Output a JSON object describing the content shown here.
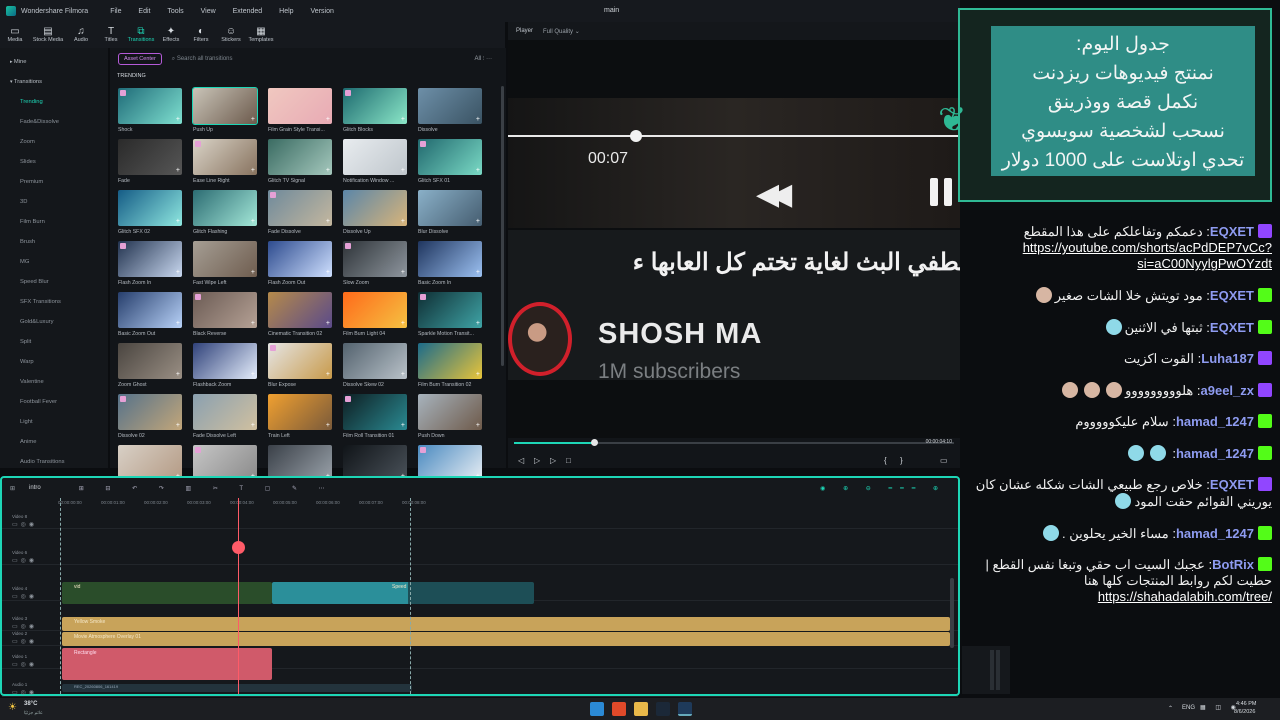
{
  "app": {
    "title": "Wondershare Filmora",
    "window_center_title": "main",
    "menu": [
      "File",
      "Edit",
      "Tools",
      "View",
      "Extended",
      "Help",
      "Version"
    ]
  },
  "toolbar": [
    {
      "label": "Media",
      "icon": "media-icon"
    },
    {
      "label": "Stock Media",
      "icon": "stock-media-icon"
    },
    {
      "label": "Audio",
      "icon": "audio-icon"
    },
    {
      "label": "Titles",
      "icon": "titles-icon"
    },
    {
      "label": "Transitions",
      "icon": "transitions-icon",
      "active": true
    },
    {
      "label": "Effects",
      "icon": "effects-icon"
    },
    {
      "label": "Filters",
      "icon": "filters-icon"
    },
    {
      "label": "Stickers",
      "icon": "stickers-icon"
    },
    {
      "label": "Templates",
      "icon": "templates-icon"
    }
  ],
  "leftnav": {
    "top": "Mine",
    "section": "Transitions",
    "items": [
      "Trending",
      "Fade&Dissolve",
      "Zoom",
      "Slides",
      "Premium",
      "3D",
      "Film Burn",
      "Brush",
      "MG",
      "Speed Blur",
      "SFX Transitions",
      "Gold&Luxury",
      "Split",
      "Warp",
      "Valentine",
      "Football Fever",
      "Light",
      "Anime",
      "Audio Transitions"
    ]
  },
  "library": {
    "asset_center": "Asset Center",
    "search_placeholder": "Search all transitions",
    "filter_label": "All",
    "section": "TRENDING",
    "items": [
      {
        "label": "Shock",
        "c1": "#1f6b78",
        "c2": "#7fe0d0"
      },
      {
        "label": "Push Up",
        "c1": "#c9c4b8",
        "c2": "#6c5a4c",
        "sel": true
      },
      {
        "label": "Film Grain Style Transi...",
        "c1": "#f0c8c0",
        "c2": "#e8aab4"
      },
      {
        "label": "Glitch Blocks",
        "c1": "#1d6a6f",
        "c2": "#8be7c8"
      },
      {
        "label": "Dissolve",
        "c1": "#6d8fa8",
        "c2": "#3a5363"
      },
      {
        "label": "Fade",
        "c1": "#2a2a2a",
        "c2": "#565656"
      },
      {
        "label": "Ease Line Right",
        "c1": "#d9d3c7",
        "c2": "#88735f"
      },
      {
        "label": "Glitch TV Signal",
        "c1": "#3a6b62",
        "c2": "#a5c8bd"
      },
      {
        "label": "Notification Window ...",
        "c1": "#e8ecef",
        "c2": "#bfc6cc"
      },
      {
        "label": "Glitch SFX 01",
        "c1": "#21686e",
        "c2": "#7adac5"
      },
      {
        "label": "Glitch SFX 02",
        "c1": "#155c86",
        "c2": "#8fe8e0"
      },
      {
        "label": "Glitch Flashing",
        "c1": "#2c6c73",
        "c2": "#a4e8d8"
      },
      {
        "label": "Fade Dissolve",
        "c1": "#6f8a9c",
        "c2": "#c4b79e"
      },
      {
        "label": "Dissolve Up",
        "c1": "#5b86a8",
        "c2": "#d8b47a"
      },
      {
        "label": "Blur Dissolve",
        "c1": "#8ab0c8",
        "c2": "#455d70"
      },
      {
        "label": "Flash Zoom In",
        "c1": "#22334f",
        "c2": "#c9d8f0"
      },
      {
        "label": "Fast Wipe Left",
        "c1": "#a59e94",
        "c2": "#6f5d4f"
      },
      {
        "label": "Flash Zoom Out",
        "c1": "#2d4b8e",
        "c2": "#cfe0ff"
      },
      {
        "label": "Slow Zoom",
        "c1": "#2e3338",
        "c2": "#8e969e"
      },
      {
        "label": "Basic Zoom In",
        "c1": "#1f355e",
        "c2": "#9cc1f2"
      },
      {
        "label": "Basic Zoom Out",
        "c1": "#263e6c",
        "c2": "#b8d2f8"
      },
      {
        "label": "Black Reverse",
        "c1": "#6b5b54",
        "c2": "#b5a195"
      },
      {
        "label": "Cinematic Transition 02",
        "c1": "#b58a4a",
        "c2": "#5a4a8a"
      },
      {
        "label": "Film Burn Light 04",
        "c1": "#ff6a1a",
        "c2": "#f5c142"
      },
      {
        "label": "Sparkle Motion Transit...",
        "c1": "#0f2e34",
        "c2": "#3fa4a6"
      },
      {
        "label": "Zoom Ghost",
        "c1": "#4a4540",
        "c2": "#9a8f84"
      },
      {
        "label": "Flashback Zoom",
        "c1": "#30427a",
        "c2": "#e5eefc"
      },
      {
        "label": "Blur Expose",
        "c1": "#e5e5e5",
        "c2": "#c89a4a"
      },
      {
        "label": "Dissolve Skew 02",
        "c1": "#53626e",
        "c2": "#b9c2c9"
      },
      {
        "label": "Film Burn Transition 02",
        "c1": "#1c6b8a",
        "c2": "#e8c43a"
      },
      {
        "label": "Dissolve 02",
        "c1": "#56728a",
        "c2": "#c2a67a"
      },
      {
        "label": "Fade Dissolve Left",
        "c1": "#8aa0b0",
        "c2": "#d0c0a0"
      },
      {
        "label": "Train Left",
        "c1": "#f0a030",
        "c2": "#7a5a3a"
      },
      {
        "label": "Film Roll Transition 01",
        "c1": "#0e1e22",
        "c2": "#2a8a92"
      },
      {
        "label": "Push Down",
        "c1": "#a7b3bd",
        "c2": "#6e5a4a"
      },
      {
        "label": "",
        "c1": "#d8d0c6",
        "c2": "#b49a84"
      },
      {
        "label": "",
        "c1": "#c6c6c6",
        "c2": "#8a8a8a"
      },
      {
        "label": "",
        "c1": "#3a4048",
        "c2": "#9aa2aa"
      },
      {
        "label": "",
        "c1": "#101418",
        "c2": "#4a525a"
      },
      {
        "label": "",
        "c1": "#4a8ac0",
        "c2": "#e8eef4"
      }
    ]
  },
  "player": {
    "label": "Player",
    "quality": "Full Quality",
    "video_time": "00:07",
    "video_caption": "نطفي البث لغاية تختم كل العابها ء",
    "channel_name": "SHOSH MA",
    "channel_subs": "1M subscribers",
    "timecode": "00:00:04:10"
  },
  "schedule": {
    "lines": [
      "جدول اليوم:",
      "نمنتج فيديوهات ريزدنت",
      "نكمل قصة ووذرينق",
      "نسحب لشخصية سويسوي",
      "تحدي اوتلاست على 1000 دولار"
    ]
  },
  "chat": [
    {
      "platform": "twitch",
      "user": "EQXET",
      "text": "دعمكم وتفاعلكم على هذا المقطع",
      "link": "https://youtube.com/shorts/acPdDEP7vCc?si=aC00NyylgPwOYzdt"
    },
    {
      "platform": "kick",
      "user": "EQXET",
      "text": "مود تويتش خلا الشات صغير",
      "emote": "face"
    },
    {
      "platform": "kick",
      "user": "EQXET",
      "text": "ثبتها في الاثنين",
      "emote": "cyan"
    },
    {
      "platform": "twitch",
      "user": "Luha187",
      "text": "القوت اكزيت"
    },
    {
      "platform": "twitch",
      "user": "a9eel_zx",
      "text": "هلووووووووو",
      "emote": "face3"
    },
    {
      "platform": "kick",
      "user": "hamad_1247",
      "text": "سلام عليكوووووم"
    },
    {
      "platform": "kick",
      "user": "hamad_1247",
      "text": "",
      "emote": "cyan2"
    },
    {
      "platform": "twitch",
      "user": "EQXET",
      "text": "خلاص رجع طبيعي الشات شكله عشان كان يوريني القوائم حقت المود",
      "emote": "cyan"
    },
    {
      "platform": "kick",
      "user": "hamad_1247",
      "text": "مساء الخير يحلوين .",
      "emote": "cyan"
    },
    {
      "platform": "kick",
      "user": "BotRix",
      "text": "عجبك السيت اب حقي وتبغا نفس القطع | حطيت لكم روابط المنتجات كلها هنا",
      "link": "https://shahadalabih.com/tree/"
    }
  ],
  "timeline": {
    "name": "intro",
    "ruler": [
      "00:00:00:00",
      "00:00:01:00",
      "00:00:02:00",
      "00:00:03:00",
      "00:00:04:00",
      "00:00:05:00",
      "00:00:06:00",
      "00:00:07:00",
      "00:00:08:00"
    ],
    "tracks": [
      "Video 8",
      "Video 6",
      "Video 4",
      "Video 3",
      "Video 2",
      "Video 1",
      "Audio 1"
    ],
    "clips": {
      "vid": "vid",
      "speed": "Speed",
      "yellow": "Yellow Smoke",
      "overlay": "Movie Atmosphere Overlay 01",
      "rect": "Rectangle",
      "audio": "REC_20260806_161419"
    }
  },
  "taskbar": {
    "temp": "38°C",
    "weather": "غائم جزئيًا",
    "lang": "ENG",
    "time": "4:46 PM",
    "date": "8/6/2026"
  },
  "colors": {
    "accent": "#1dd6b6",
    "twitch": "#9146ff",
    "kick": "#53fc18",
    "playhead": "#ff5b68"
  }
}
